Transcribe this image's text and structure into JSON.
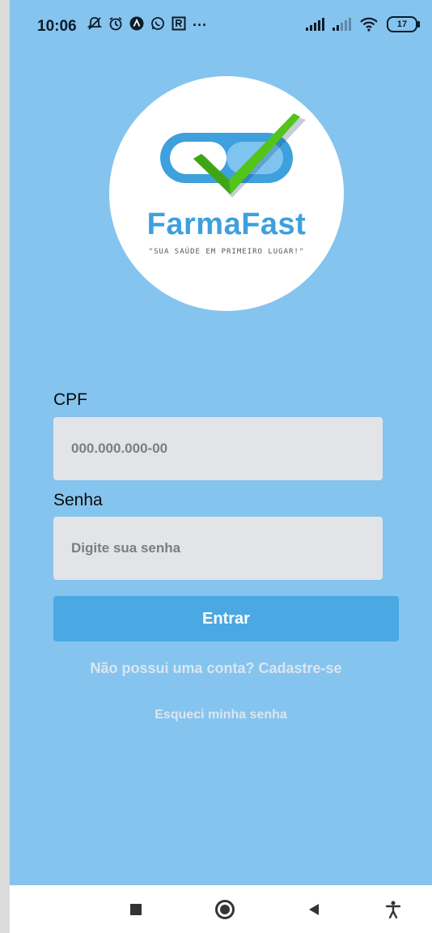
{
  "status_bar": {
    "time": "10:06",
    "more": "···",
    "battery": "17"
  },
  "logo": {
    "brand": "FarmaFast",
    "tagline": "\"SUA SAÚDE EM PRIMEIRO LUGAR!\""
  },
  "form": {
    "cpf_label": "CPF",
    "cpf_placeholder": "000.000.000-00",
    "password_label": "Senha",
    "password_placeholder": "Digite sua senha",
    "submit_label": "Entrar"
  },
  "links": {
    "signup": "Não possui uma conta? Cadastre-se",
    "forgot": "Esqueci minha senha"
  },
  "icons": {
    "status_left": [
      "mute-icon",
      "alarm-icon",
      "app-icon",
      "whatsapp-icon",
      "recorder-icon"
    ],
    "status_right": [
      "signal-icon",
      "signal-icon",
      "wifi-icon",
      "battery-icon"
    ],
    "nav": [
      "recents-icon",
      "home-icon",
      "back-icon",
      "accessibility-icon"
    ]
  },
  "colors": {
    "background": "#85c4ee",
    "input_bg": "#e3e4e8",
    "button": "#4aa8e2",
    "brand_blue": "#3ea0dd",
    "check_green": "#52c41a"
  }
}
